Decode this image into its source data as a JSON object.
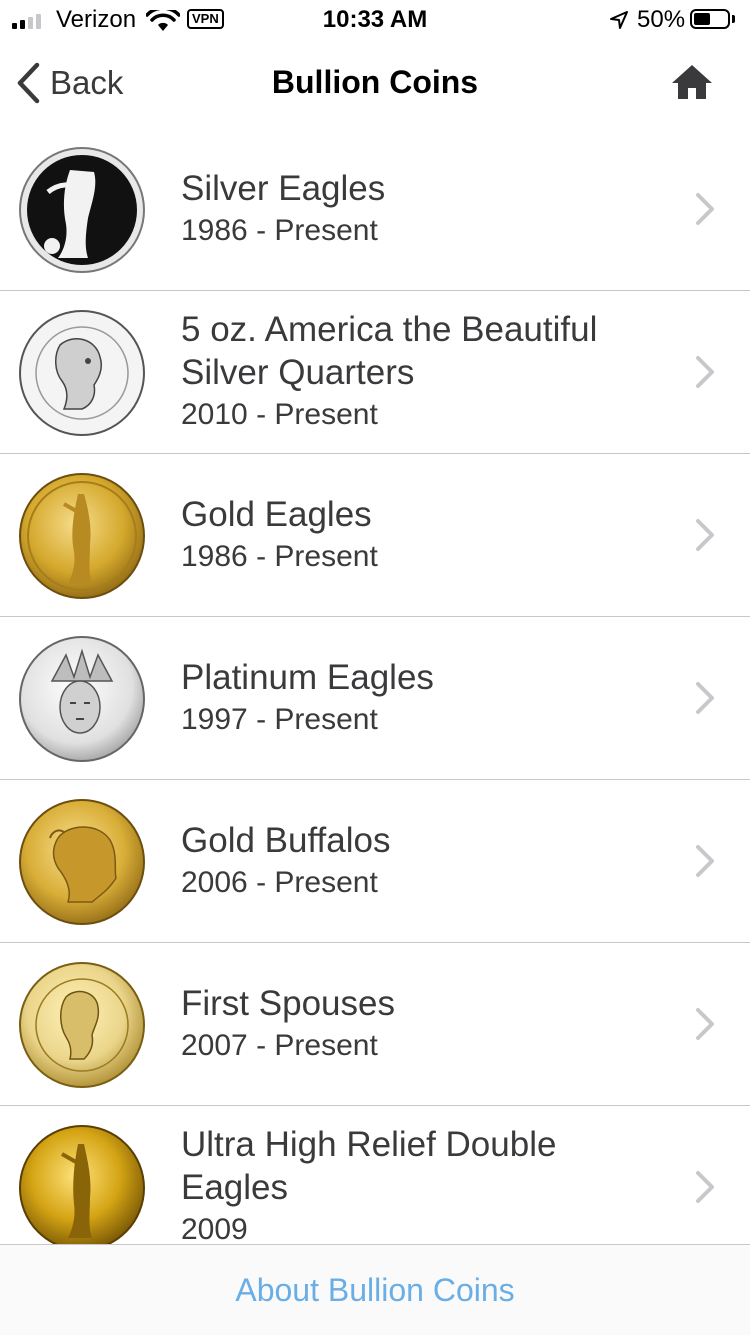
{
  "status_bar": {
    "carrier": "Verizon",
    "vpn": "VPN",
    "time": "10:33 AM",
    "battery_percent": "50%",
    "battery_level": 0.5,
    "signal_bars_active": 2,
    "signal_bars_total": 4
  },
  "nav": {
    "back_label": "Back",
    "title": "Bullion Coins",
    "home_icon": "home-icon",
    "back_icon": "chevron-left-icon"
  },
  "coins": [
    {
      "title": "Silver Eagles",
      "subtitle": "1986 - Present",
      "metal": "silver"
    },
    {
      "title": "5 oz. America the Beautiful Silver Quarters",
      "subtitle": "2010 - Present",
      "metal": "silver"
    },
    {
      "title": "Gold Eagles",
      "subtitle": "1986 - Present",
      "metal": "gold"
    },
    {
      "title": "Platinum Eagles",
      "subtitle": "1997 - Present",
      "metal": "platinum"
    },
    {
      "title": "Gold Buffalos",
      "subtitle": "2006 - Present",
      "metal": "gold"
    },
    {
      "title": "First Spouses",
      "subtitle": "2007 - Present",
      "metal": "gold"
    },
    {
      "title": "Ultra High Relief Double Eagles",
      "subtitle": "2009",
      "metal": "gold"
    }
  ],
  "footer": {
    "link_label": "About Bullion Coins"
  },
  "colors": {
    "accent": "#6aaee6",
    "text": "#3a3a3c",
    "separator": "#c8c7cc",
    "chevron": "#c7c7cc",
    "silver": "#d9d9d9",
    "gold": "#d4a82c",
    "platinum": "#e6e6e6"
  }
}
